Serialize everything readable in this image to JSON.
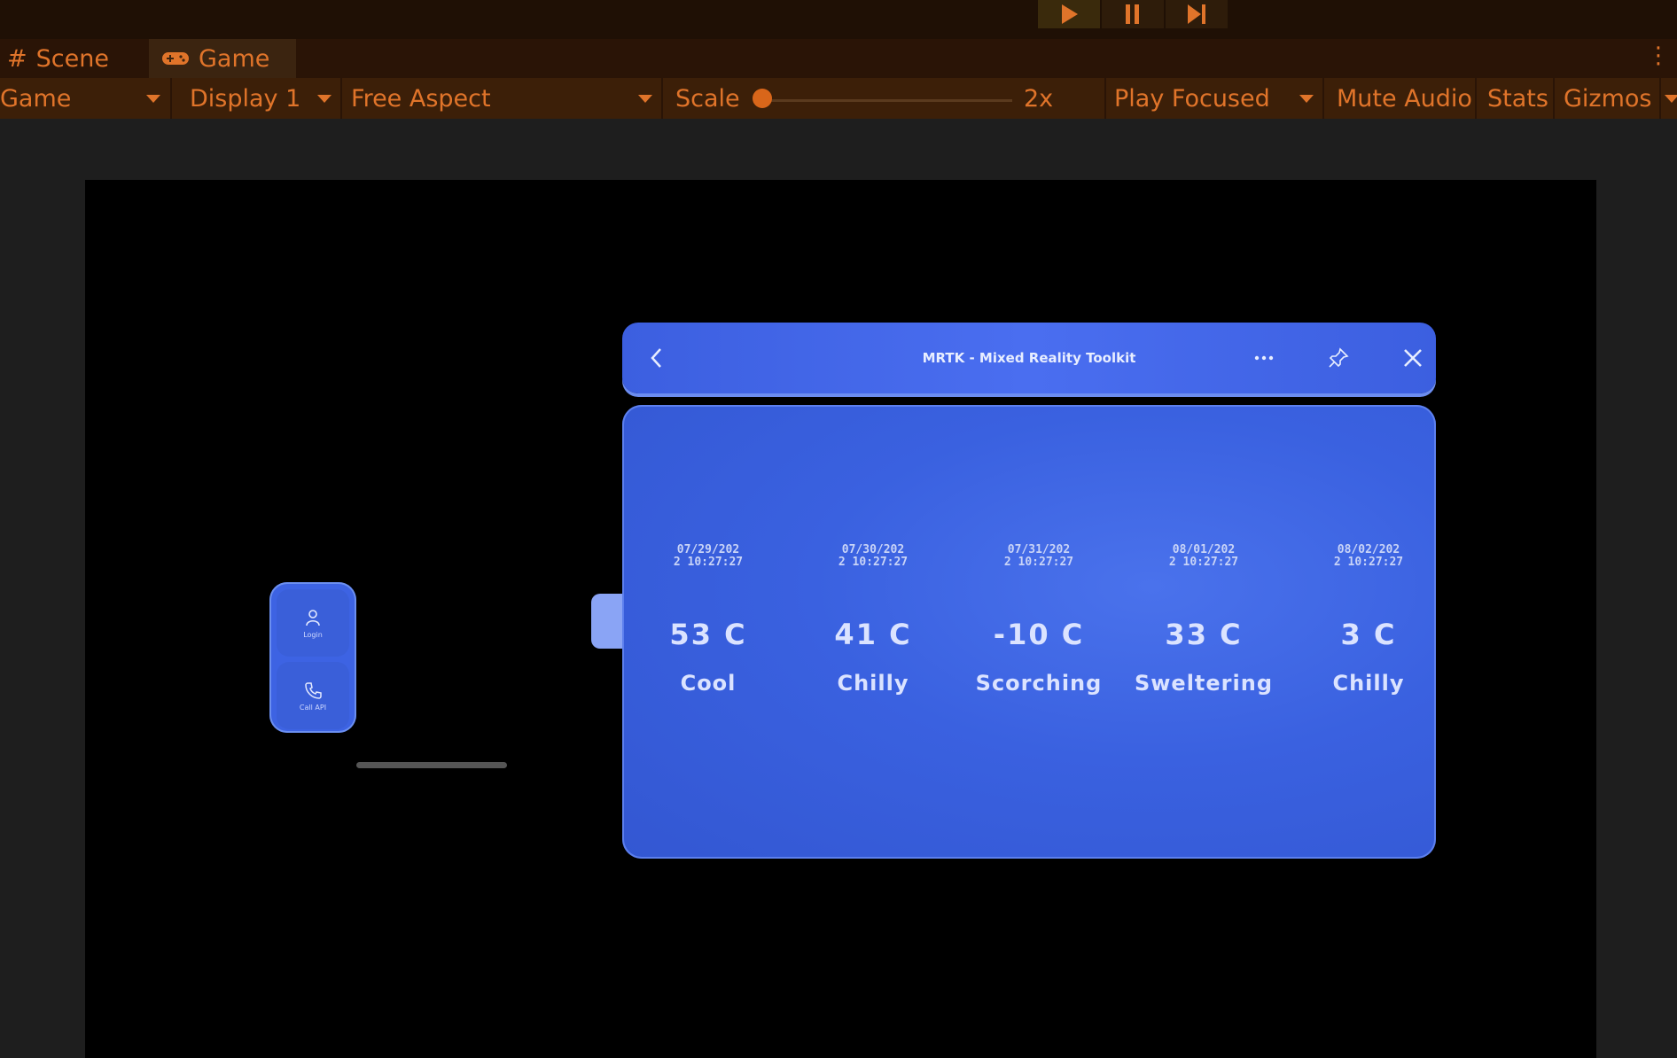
{
  "playbar": {
    "play_icon": "play-icon",
    "pause_icon": "pause-icon",
    "step_icon": "step-icon"
  },
  "tabs": [
    {
      "label": "Scene",
      "icon": "hash-icon"
    },
    {
      "label": "Game",
      "icon": "gamepad-icon"
    }
  ],
  "toolbar": {
    "game_select": "Game",
    "display_select": "Display 1",
    "aspect_select": "Free Aspect",
    "scale_label": "Scale",
    "scale_value": "2x",
    "scale_level": 0.0,
    "play_mode_select": "Play Focused",
    "mute_audio": "Mute Audio",
    "stats": "Stats",
    "gizmos": "Gizmos"
  },
  "colors": {
    "accent": "#e0742a",
    "toolbar_bg": "#3c1f08",
    "panel_blue": "#3a61e0"
  },
  "hand_menu": {
    "items": [
      {
        "label": "Login",
        "icon": "person-icon"
      },
      {
        "label": "Call API",
        "icon": "phone-icon"
      }
    ]
  },
  "window": {
    "title": "MRTK - Mixed Reality Toolkit",
    "back_icon": "chevron-left-icon",
    "more_icon": "ellipsis-icon",
    "pin_icon": "pin-icon",
    "close_icon": "close-icon"
  },
  "forecast": [
    {
      "date": "07/29/202\n2 10:27:27",
      "temp": "53 C",
      "desc": "Cool"
    },
    {
      "date": "07/30/202\n2 10:27:27",
      "temp": "41 C",
      "desc": "Chilly"
    },
    {
      "date": "07/31/202\n2 10:27:27",
      "temp": "-10 C",
      "desc": "Scorching"
    },
    {
      "date": "08/01/202\n2 10:27:27",
      "temp": "33 C",
      "desc": "Sweltering"
    },
    {
      "date": "08/02/202\n2 10:27:27",
      "temp": "3 C",
      "desc": "Chilly"
    }
  ]
}
